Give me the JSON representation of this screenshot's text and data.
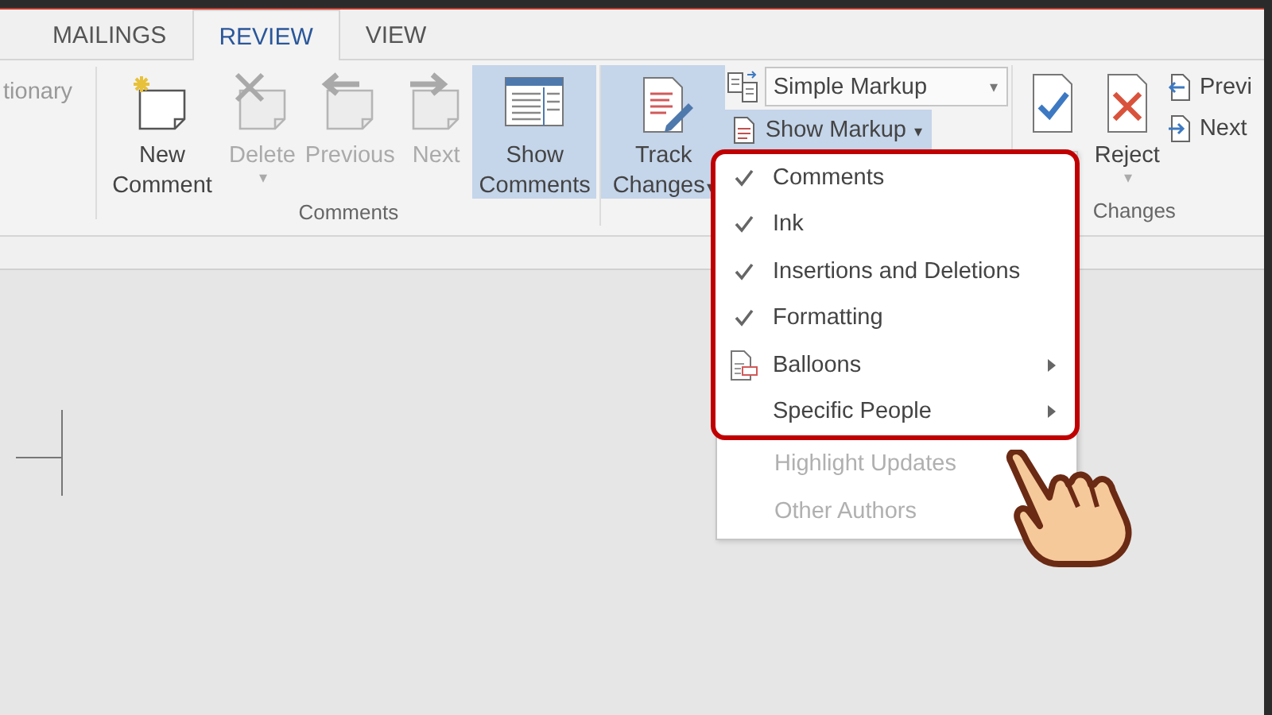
{
  "tabs": [
    {
      "label": "MAILINGS",
      "selected": false
    },
    {
      "label": "REVIEW",
      "selected": true
    },
    {
      "label": "VIEW",
      "selected": false
    }
  ],
  "ribbon": {
    "cut_group_label": "tionary",
    "groups": [
      {
        "label": "Comments",
        "buttons": [
          {
            "kind": "new",
            "label": "New Comment",
            "disabled": false,
            "selected": false
          },
          {
            "kind": "delete",
            "label": "Delete",
            "disabled": true,
            "selected": false,
            "caret": "▾"
          },
          {
            "kind": "previous",
            "label": "Previous",
            "disabled": true,
            "selected": false
          },
          {
            "kind": "next",
            "label": "Next",
            "disabled": true,
            "selected": false
          },
          {
            "kind": "show",
            "label": "Show Comments",
            "disabled": false,
            "selected": true
          }
        ]
      },
      {
        "buttons": [
          {
            "kind": "track",
            "label": "Track Changes",
            "disabled": false,
            "selected": true,
            "caret": "▾"
          }
        ],
        "markup_select": {
          "value": "Simple Markup",
          "caret": "▾"
        },
        "show_markup": {
          "label": "Show Markup",
          "caret": "▾",
          "selected": true
        }
      },
      {
        "label": "Changes",
        "buttons": [
          {
            "kind": "accept",
            "selected": false
          },
          {
            "kind": "reject",
            "label": "Reject",
            "disabled": false,
            "selected": false,
            "caret": "▾"
          }
        ],
        "small_buttons": [
          {
            "kind": "prev",
            "label": "Previ"
          },
          {
            "kind": "next",
            "label": "Next"
          }
        ]
      }
    ]
  },
  "menu": {
    "items": [
      {
        "kind": "check",
        "label": "Comments",
        "checked": true,
        "disabled": false,
        "submenu": false,
        "highlighted": true
      },
      {
        "kind": "check",
        "label": "Ink",
        "checked": true,
        "disabled": false,
        "submenu": false,
        "highlighted": true
      },
      {
        "kind": "check",
        "label": "Insertions and Deletions",
        "checked": true,
        "disabled": false,
        "submenu": false,
        "highlighted": true
      },
      {
        "kind": "check",
        "label": "Formatting",
        "checked": true,
        "disabled": false,
        "submenu": false,
        "highlighted": true
      },
      {
        "kind": "icon",
        "label": "Balloons",
        "disabled": false,
        "submenu": true,
        "highlighted": true
      },
      {
        "kind": "check",
        "label": "Specific People",
        "checked": false,
        "disabled": false,
        "submenu": true,
        "highlighted": true
      },
      {
        "kind": "check",
        "label": "Highlight Updates",
        "checked": false,
        "disabled": true,
        "submenu": false,
        "highlighted": false
      },
      {
        "kind": "check",
        "label": "Other Authors",
        "checked": false,
        "disabled": true,
        "submenu": false,
        "highlighted": false
      }
    ]
  }
}
